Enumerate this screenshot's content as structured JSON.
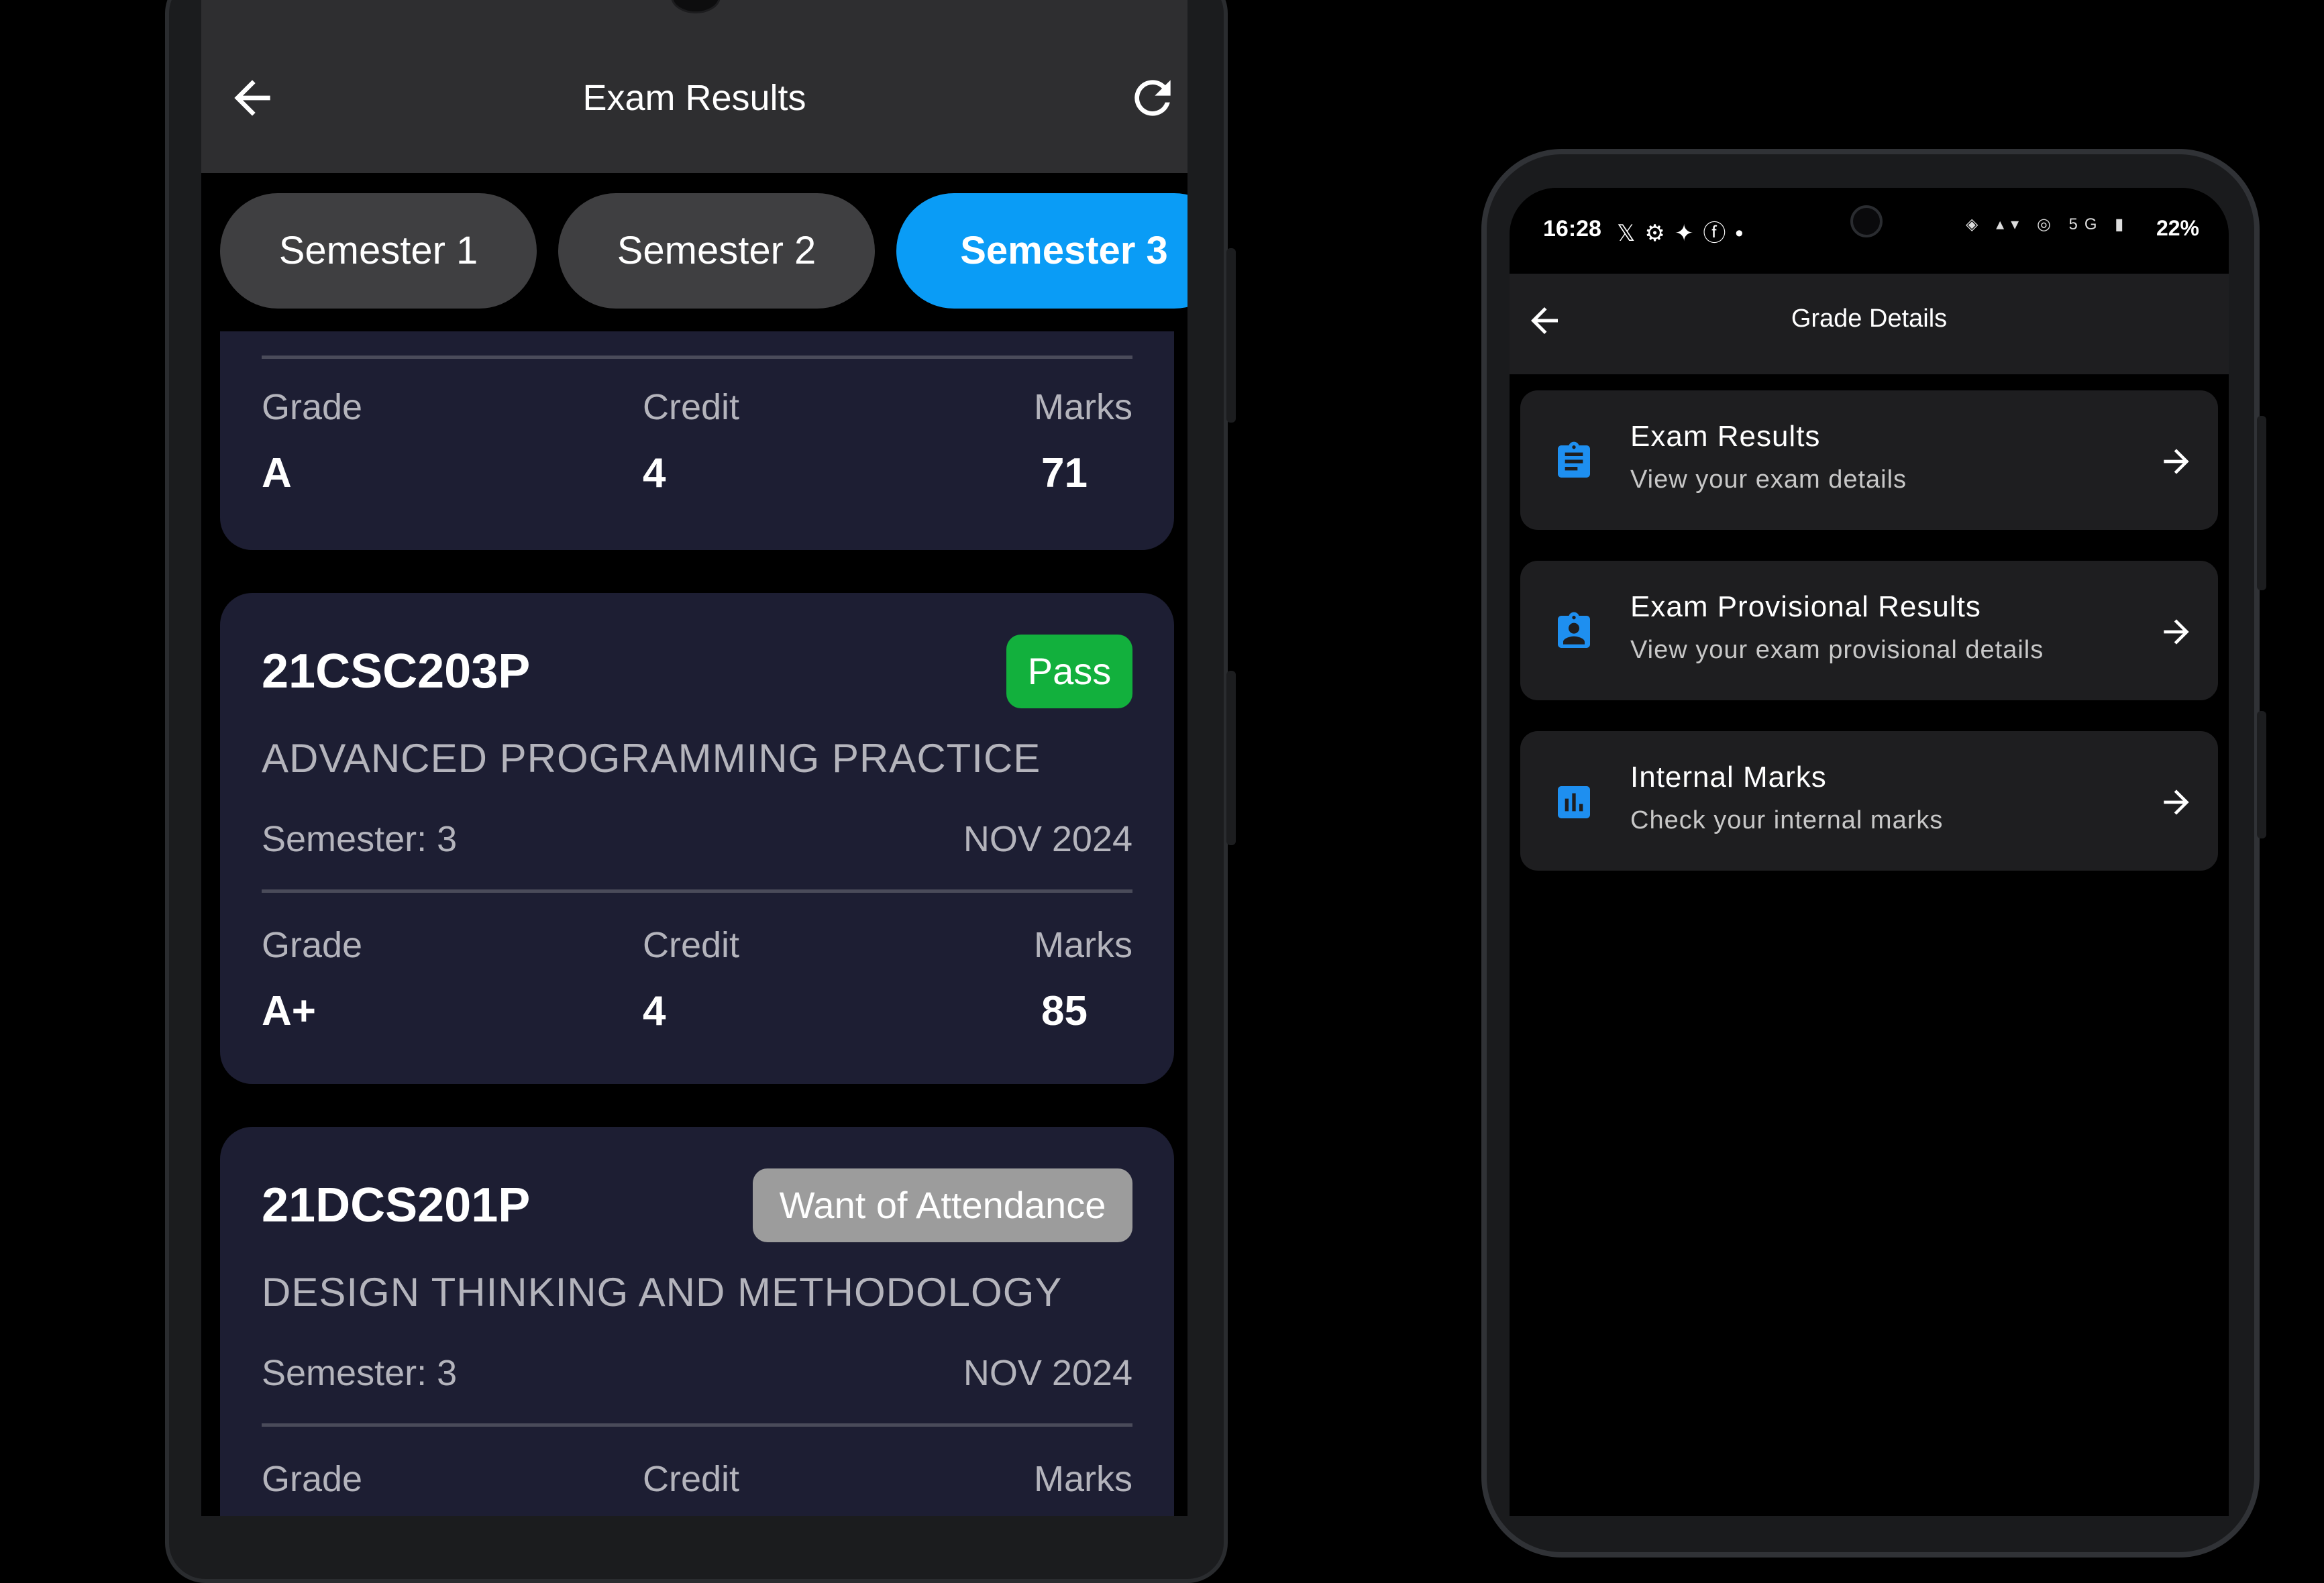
{
  "left_screen": {
    "title": "Exam Results",
    "icons": {
      "back": "back-arrow-icon",
      "refresh": "refresh-icon"
    },
    "semesters": [
      {
        "label": "Semester 1",
        "active": false
      },
      {
        "label": "Semester 2",
        "active": false
      },
      {
        "label": "Semester 3",
        "active": true
      }
    ],
    "partial_card": {
      "grade_label": "Grade",
      "credit_label": "Credit",
      "marks_label": "Marks",
      "grade": "A",
      "credit": "4",
      "marks": "71"
    },
    "cards": [
      {
        "code": "21CSC203P",
        "status": "Pass",
        "name": "ADVANCED PROGRAMMING PRACTICE",
        "semester": "Semester: 3",
        "date": "NOV 2024",
        "grade_label": "Grade",
        "credit_label": "Credit",
        "marks_label": "Marks",
        "grade": "A+",
        "credit": "4",
        "marks": "85"
      },
      {
        "code": "21DCS201P",
        "status": "Want of Attendance",
        "name": "DESIGN THINKING AND METHODOLOGY",
        "semester": "Semester: 3",
        "date": "NOV 2024",
        "grade_label": "Grade",
        "credit_label": "Credit",
        "marks_label": "Marks"
      }
    ],
    "colors": {
      "active_tab": "#0a9cf6",
      "pass": "#12b03d",
      "woa": "#9c9c9c",
      "card": "#1d1e33"
    }
  },
  "right_screen": {
    "status_bar": {
      "time": "16:28",
      "battery": "22%",
      "network": "5G"
    },
    "title": "Grade Details",
    "items": [
      {
        "title": "Exam Results",
        "subtitle": "View your exam details",
        "icon": "clipboard-icon"
      },
      {
        "title": "Exam Provisional Results",
        "subtitle": "View your exam provisional details",
        "icon": "badge-icon"
      },
      {
        "title": "Internal Marks",
        "subtitle": "Check your internal marks",
        "icon": "bar-chart-icon"
      }
    ],
    "colors": {
      "icon": "#1e8ff0"
    }
  }
}
